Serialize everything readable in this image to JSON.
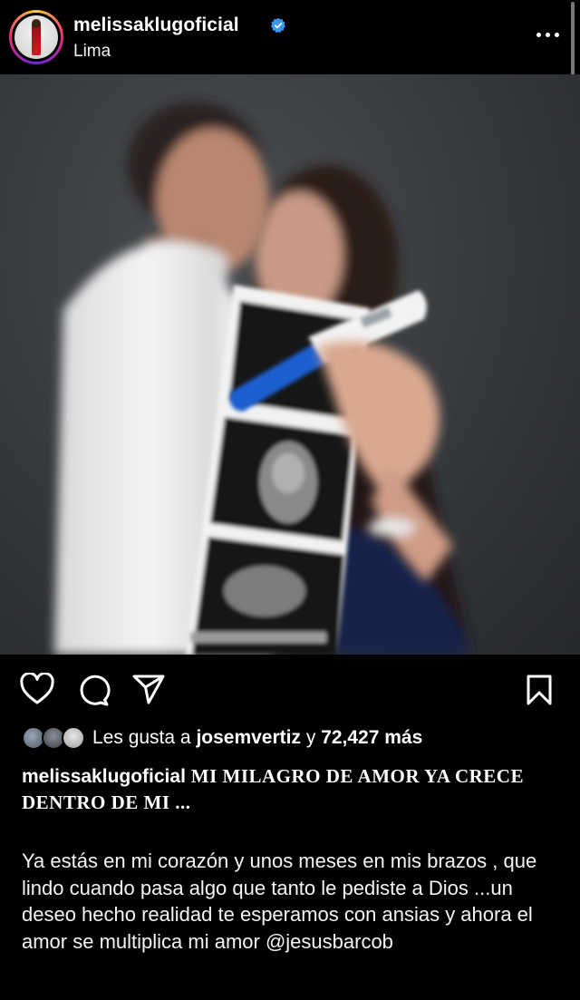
{
  "post": {
    "username": "melissaklugoficial",
    "location": "Lima",
    "verified": true
  },
  "likes": {
    "prefix": "Les gusta a",
    "liker": "josemvertiz",
    "connector": "y",
    "count_text": "72,427 más"
  },
  "caption": {
    "username": "melissaklugoficial",
    "title": "MI MILAGRO DE AMOR YA CRECE DENTRO DE MI ...",
    "body": "Ya estás en mi corazón y unos meses en mis brazos , que lindo cuando pasa algo que tanto le pediste a Dios ...un deseo hecho realidad te esperamos con ansias y ahora el amor se multiplica mi amor @jesusbarcob"
  },
  "icons": {
    "like": "heart-outline-icon",
    "comment": "comment-bubble-icon",
    "share": "paper-plane-icon",
    "save": "bookmark-outline-icon",
    "more": "ellipsis-icon",
    "verified": "verified-badge-icon"
  },
  "colors": {
    "background": "#000000",
    "text": "#ffffff",
    "verified": "#3897f0"
  }
}
